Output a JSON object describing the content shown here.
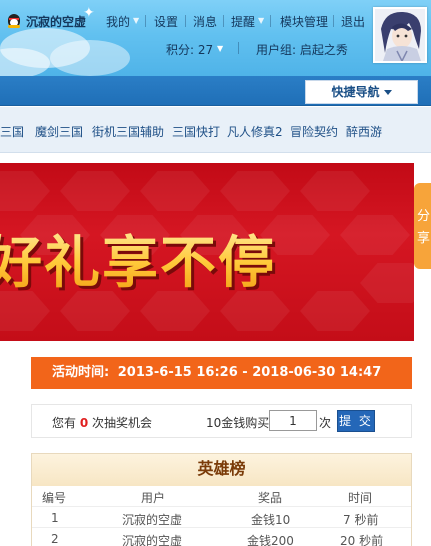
{
  "header": {
    "username": "沉寂的空虚",
    "nav": [
      {
        "label": "我的"
      },
      {
        "label": "设置"
      },
      {
        "label": "消息"
      },
      {
        "label": "提醒"
      },
      {
        "label": "模块管理"
      },
      {
        "label": "退出"
      }
    ],
    "credits": "积分: 27",
    "user_group": "用户组: 启起之秀"
  },
  "quick_nav": {
    "label": "快捷导航"
  },
  "games": [
    "弓三国",
    "魔剑三国",
    "街机三国辅助",
    "三国快打",
    "凡人修真2",
    "冒险契约",
    "醉西游"
  ],
  "banner": {
    "text": "好礼享不停"
  },
  "share_tab": {
    "text": "分享"
  },
  "activity": {
    "label": "活动时间:",
    "range": "2013-6-15 16:26 - 2018-06-30 14:47"
  },
  "lottery": {
    "prefix": "您有",
    "count": "0",
    "suffix": "次抽奖机会",
    "buy_label": "10金钱购买",
    "quantity": "1",
    "unit": "次",
    "submit_label": "提 交"
  },
  "ranking": {
    "title": "英雄榜",
    "columns": [
      "编号",
      "用户",
      "奖品",
      "时间"
    ],
    "rows": [
      {
        "id": "1",
        "user": "沉寂的空虚",
        "prize": "金钱10",
        "time": "7 秒前"
      },
      {
        "id": "2",
        "user": "沉寂的空虚",
        "prize": "金钱200",
        "time": "20 秒前"
      }
    ]
  },
  "colors": {
    "header_sky": "#62c1f0",
    "nav_blue": "#1f6fb7",
    "banner_red": "#c20a16",
    "activity_orange": "#f2651a",
    "submit_blue": "#2467b8",
    "share_orange": "#f7a43a"
  }
}
